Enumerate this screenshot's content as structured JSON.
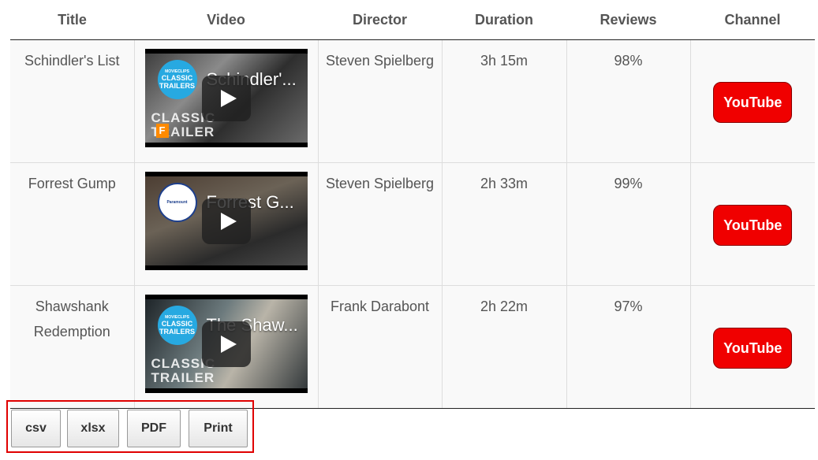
{
  "table": {
    "headers": [
      "Title",
      "Video",
      "Director",
      "Duration",
      "Reviews",
      "Channel"
    ],
    "rows": [
      {
        "title": "Schindler's List",
        "video_title": "Schindler'...",
        "director": "Steven Spielberg",
        "duration": "3h 15m",
        "reviews": "98%",
        "channel": "YouTube",
        "thumb_badge_top": "MOVIECLIPS",
        "thumb_badge": "CLASSIC TRAILERS",
        "thumb_text": "CLASSIC",
        "thumb_text_2": "TRAILER"
      },
      {
        "title": "Forrest Gump",
        "video_title": "Forrest G...",
        "director": "Steven Spielberg",
        "duration": "2h 33m",
        "reviews": "99%",
        "channel": "YouTube",
        "thumb_badge_top": "",
        "thumb_badge": "Paramount",
        "thumb_text": "",
        "thumb_text_2": ""
      },
      {
        "title": "Shawshank Redemption",
        "video_title": "The Shaw...",
        "director": "Frank Darabont",
        "duration": "2h 22m",
        "reviews": "97%",
        "channel": "YouTube",
        "thumb_badge_top": "MOVIECLIPS",
        "thumb_badge": "CLASSIC TRAILERS",
        "thumb_text": "CLASSIC",
        "thumb_text_2": "TRAILER"
      }
    ]
  },
  "export_buttons": {
    "csv": "csv",
    "xlsx": "xlsx",
    "pdf": "PDF",
    "print": "Print"
  },
  "colors": {
    "youtube_red": "#f00000",
    "highlight_border": "#e00000",
    "text": "#555555"
  },
  "icons": {
    "play": "play-icon",
    "channel_logo": "channel-logo-icon"
  }
}
